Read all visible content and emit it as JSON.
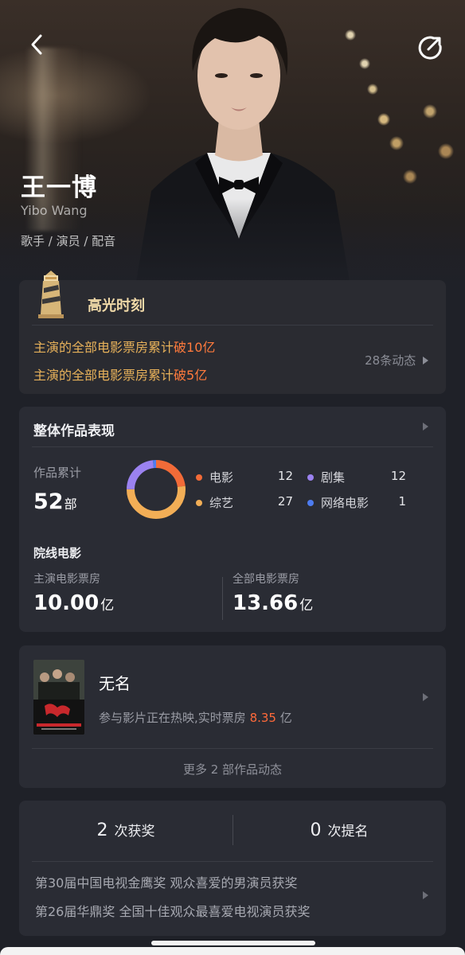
{
  "hero": {
    "name": "王一博",
    "english_name": "Yibo Wang",
    "roles": "歌手 / 演员 / 配音"
  },
  "highlight": {
    "title": "高光时刻",
    "items": [
      {
        "prefix": "主演的全部电影票房累计",
        "emphasis": "破10亿"
      },
      {
        "prefix": "主演的全部电影票房累计",
        "emphasis": "破5亿"
      }
    ],
    "more": "28条动态"
  },
  "works": {
    "title": "整体作品表现",
    "count_label": "作品累计",
    "count_value": "52",
    "count_unit": "部",
    "legend": [
      {
        "label": "电影",
        "value": "12",
        "color": "#f26b38"
      },
      {
        "label": "综艺",
        "value": "27",
        "color": "#f2ae56"
      },
      {
        "label": "剧集",
        "value": "12",
        "color": "#9b82f0"
      },
      {
        "label": "网络电影",
        "value": "1",
        "color": "#4d7cf0"
      }
    ],
    "cinema_title": "院线电影",
    "lead_box_label": "主演电影票房",
    "lead_box_value": "10.00",
    "lead_box_unit": "亿",
    "total_box_label": "全部电影票房",
    "total_box_value": "13.66",
    "total_box_unit": "亿"
  },
  "movie": {
    "title": "无名",
    "status_prefix": "参与影片正在热映,实时票房",
    "status_value": "8.35",
    "status_unit": "亿",
    "more": "更多 2 部作品动态"
  },
  "awards": {
    "wins_num": "2",
    "wins_label": "次获奖",
    "noms_num": "0",
    "noms_label": "次提名",
    "items": [
      "第30届中国电视金鹰奖 观众喜爱的男演员获奖",
      "第26届华鼎奖 全国十佳观众最喜爱电视演员获奖"
    ]
  }
}
